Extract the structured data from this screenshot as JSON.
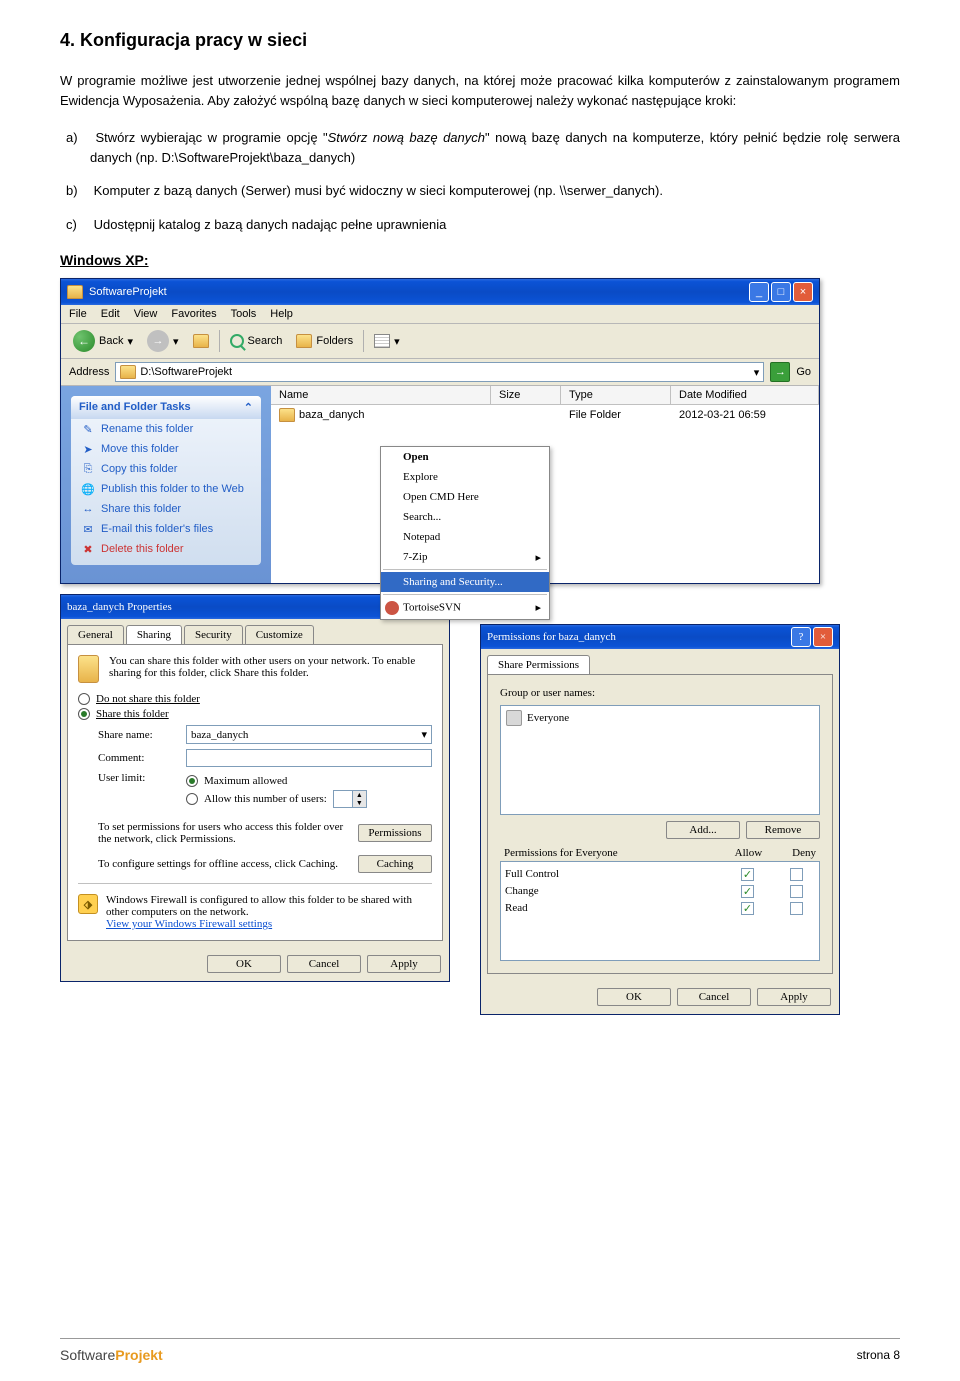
{
  "heading": "4. Konfiguracja pracy w sieci",
  "intro": "W programie możliwe jest utworzenie jednej wspólnej bazy danych, na której może pracować kilka komputerów z zainstalowanym programem Ewidencja Wyposażenia. Aby założyć wspólną bazę danych w sieci komputerowej należy wykonać następujące kroki:",
  "items": {
    "a": {
      "lbl": "a)",
      "pre": "Stwórz wybierając w programie opcję \"",
      "italic": "Stwórz nową bazę danych",
      "post": "\" nową bazę danych na komputerze, który pełnić będzie rolę serwera danych (np. D:\\SoftwareProjekt\\baza_danych)"
    },
    "b": {
      "lbl": "b)",
      "text": "Komputer z bazą danych (Serwer) musi być widoczny w sieci komputerowej (np. \\\\serwer_danych)."
    },
    "c": {
      "lbl": "c)",
      "text": "Udostępnij katalog z bazą danych nadając pełne uprawnienia"
    }
  },
  "subhead": "Windows XP:",
  "explorer": {
    "title": "SoftwareProjekt",
    "menu": [
      "File",
      "Edit",
      "View",
      "Favorites",
      "Tools",
      "Help"
    ],
    "back": "Back",
    "search": "Search",
    "folders": "Folders",
    "addr_label": "Address",
    "addr_value": "D:\\SoftwareProjekt",
    "go": "Go",
    "side_title": "File and Folder Tasks",
    "side_items": [
      "Rename this folder",
      "Move this folder",
      "Copy this folder",
      "Publish this folder to the Web",
      "Share this folder",
      "E-mail this folder's files",
      "Delete this folder"
    ],
    "cols": [
      "Name",
      "Size",
      "Type",
      "Date Modified"
    ],
    "row_name": "baza_danych",
    "row_type": "File Folder",
    "row_date": "2012-03-21 06:59",
    "ctx": {
      "open": "Open",
      "explore": "Explore",
      "cmd": "Open CMD Here",
      "search": "Search...",
      "notepad": "Notepad",
      "zip": "7-Zip",
      "sharing": "Sharing and Security...",
      "svn": "TortoiseSVN"
    }
  },
  "props": {
    "title": "baza_danych Properties",
    "tabs": [
      "General",
      "Sharing",
      "Security",
      "Customize"
    ],
    "share_intro": "You can share this folder with other users on your network. To enable sharing for this folder, click Share this folder.",
    "radio_no": "Do not share this folder",
    "radio_yes": "Share this folder",
    "share_name_lbl": "Share name:",
    "share_name_val": "baza_danych",
    "comment_lbl": "Comment:",
    "userlimit_lbl": "User limit:",
    "max_allowed": "Maximum allowed",
    "allow_num": "Allow this number of users:",
    "perm_text": "To set permissions for users who access this folder over the network, click Permissions.",
    "perm_btn": "Permissions",
    "cache_text": "To configure settings for offline access, click Caching.",
    "cache_btn": "Caching",
    "fw_text": "Windows Firewall is configured to allow this folder to be shared with other computers on the network.",
    "fw_link": "View your Windows Firewall settings",
    "ok": "OK",
    "cancel": "Cancel",
    "apply": "Apply"
  },
  "perms": {
    "title": "Permissions for baza_danych",
    "tab": "Share Permissions",
    "group_lbl": "Group or user names:",
    "everyone": "Everyone",
    "add": "Add...",
    "remove": "Remove",
    "header": "Permissions for Everyone",
    "allow": "Allow",
    "deny": "Deny",
    "rows": [
      "Full Control",
      "Change",
      "Read"
    ],
    "ok": "OK",
    "cancel": "Cancel",
    "apply": "Apply"
  },
  "footer": {
    "brand1": "Software",
    "brand2": "Projekt",
    "page": "strona 8"
  }
}
